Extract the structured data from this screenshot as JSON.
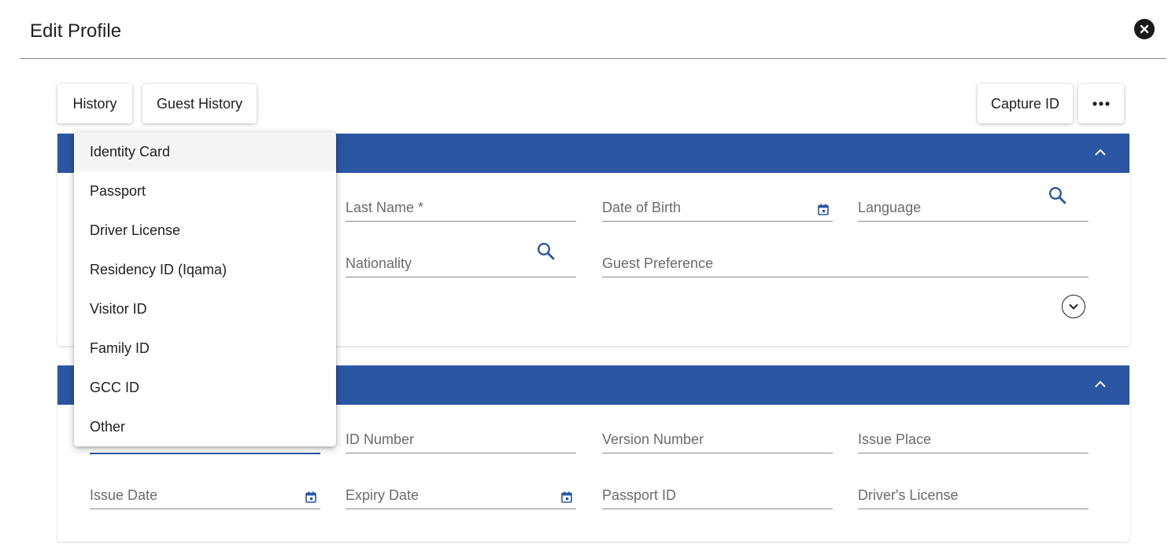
{
  "dialog": {
    "title": "Edit Profile"
  },
  "toolbar": {
    "history_label": "History",
    "guest_history_label": "Guest History",
    "capture_id_label": "Capture ID",
    "more_label": "•••"
  },
  "profile_section": {
    "fields": {
      "last_name": "Last Name *",
      "date_of_birth": "Date of Birth",
      "language": "Language",
      "nationality": "Nationality",
      "guest_preference": "Guest Preference"
    }
  },
  "identity_section": {
    "fields": {
      "id_number": "ID Number",
      "version_number": "Version Number",
      "issue_place": "Issue Place",
      "issue_date": "Issue Date",
      "expiry_date": "Expiry Date",
      "passport_id": "Passport ID",
      "drivers_license": "Driver's License"
    }
  },
  "id_type_menu": {
    "items": [
      "Identity Card",
      "Passport",
      "Driver License",
      "Residency ID (Iqama)",
      "Visitor ID",
      "Family ID",
      "GCC ID",
      "Other"
    ],
    "highlighted": "Identity Card"
  },
  "colors": {
    "header_blue": "#2a56a4",
    "icon_blue": "#2a56a4",
    "text": "#212121",
    "label": "#6b6b6b"
  },
  "icons": [
    "close-icon",
    "chevron-up-icon",
    "calendar-icon",
    "search-icon",
    "chevron-down-icon",
    "more-icon"
  ]
}
